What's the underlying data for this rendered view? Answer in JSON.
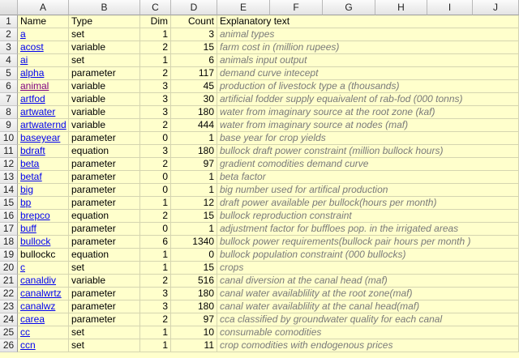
{
  "columns": [
    "A",
    "B",
    "C",
    "D",
    "E",
    "F",
    "G",
    "H",
    "I",
    "J"
  ],
  "header_row": {
    "num": "1",
    "a": "Name",
    "b": "Type",
    "c": "Dim",
    "d": "Count",
    "e": "Explanatory text"
  },
  "rows": [
    {
      "num": "2",
      "a": "a",
      "b": "set",
      "c": "1",
      "d": "3",
      "e": "animal types",
      "link": true
    },
    {
      "num": "3",
      "a": "acost",
      "b": "variable",
      "c": "2",
      "d": "15",
      "e": "farm cost in            (million rupees)",
      "link": true
    },
    {
      "num": "4",
      "a": "ai",
      "b": "set",
      "c": "1",
      "d": "6",
      "e": "animals input output",
      "link": true
    },
    {
      "num": "5",
      "a": "alpha",
      "b": "parameter",
      "c": "2",
      "d": "117",
      "e": "demand curve intecept",
      "link": true
    },
    {
      "num": "6",
      "a": "animal",
      "b": "variable",
      "c": "3",
      "d": "45",
      "e": "production of livestock type a                    (thousands)",
      "link": true,
      "visited": true
    },
    {
      "num": "7",
      "a": "artfod",
      "b": "variable",
      "c": "3",
      "d": "30",
      "e": "artificial fodder supply  equaivalent of rab-fod   (000 tonns)",
      "link": true
    },
    {
      "num": "8",
      "a": "artwater",
      "b": "variable",
      "c": "3",
      "d": "180",
      "e": "water from imaginary source at the root zone        (kaf)",
      "link": true
    },
    {
      "num": "9",
      "a": "artwaternd",
      "b": "variable",
      "c": "2",
      "d": "444",
      "e": "water from imaginary source at nodes                 (maf)",
      "link": true
    },
    {
      "num": "10",
      "a": "baseyear",
      "b": "parameter",
      "c": "0",
      "d": "1",
      "e": "base year for crop yields",
      "link": true
    },
    {
      "num": "11",
      "a": "bdraft",
      "b": "equation",
      "c": "3",
      "d": "180",
      "e": "bullock draft power constraint                (million bullock hours)",
      "link": true
    },
    {
      "num": "12",
      "a": "beta",
      "b": "parameter",
      "c": "2",
      "d": "97",
      "e": "gradient comodities demand curve",
      "link": true
    },
    {
      "num": "13",
      "a": "betaf",
      "b": "parameter",
      "c": "0",
      "d": "1",
      "e": "beta factor",
      "link": true
    },
    {
      "num": "14",
      "a": "big",
      "b": "parameter",
      "c": "0",
      "d": "1",
      "e": "big number used for artifical production",
      "link": true
    },
    {
      "num": "15",
      "a": "bp",
      "b": "parameter",
      "c": "1",
      "d": "12",
      "e": "draft power available per bullock(hours per month)",
      "link": true
    },
    {
      "num": "16",
      "a": "brepco",
      "b": "equation",
      "c": "2",
      "d": "15",
      "e": "bullock reproduction constraint",
      "link": true
    },
    {
      "num": "17",
      "a": "buff",
      "b": "parameter",
      "c": "0",
      "d": "1",
      "e": "adjustment factor for buffloes pop.   in the irrigated areas",
      "link": true
    },
    {
      "num": "18",
      "a": "bullock",
      "b": "parameter",
      "c": "6",
      "d": "1340",
      "e": "bullock power requirements(bullock pair hours per month )",
      "link": true
    },
    {
      "num": "19",
      "a": "bullockc",
      "b": "equation",
      "c": "1",
      "d": "0",
      "e": "bullock population constraint                 (000 bullocks)",
      "link": false
    },
    {
      "num": "20",
      "a": "c",
      "b": "set",
      "c": "1",
      "d": "15",
      "e": "crops",
      "link": true
    },
    {
      "num": "21",
      "a": "canaldiv",
      "b": "variable",
      "c": "2",
      "d": "516",
      "e": "canal diversion at the canal head                    (maf)",
      "link": true
    },
    {
      "num": "22",
      "a": "canalwrtz",
      "b": "parameter",
      "c": "3",
      "d": "180",
      "e": "canal water availablility at the root zone(maf)",
      "link": true
    },
    {
      "num": "23",
      "a": "canalwz",
      "b": "parameter",
      "c": "3",
      "d": "180",
      "e": "canal water availablility at the canal head(maf)",
      "link": true
    },
    {
      "num": "24",
      "a": "carea",
      "b": "parameter",
      "c": "2",
      "d": "97",
      "e": "cca classified by groundwater quality for each canal",
      "link": true
    },
    {
      "num": "25",
      "a": "cc",
      "b": "set",
      "c": "1",
      "d": "10",
      "e": "consumable comodities",
      "link": true
    },
    {
      "num": "26",
      "a": "ccn",
      "b": "set",
      "c": "1",
      "d": "11",
      "e": "crop comodities with endogenous prices",
      "link": true
    }
  ]
}
